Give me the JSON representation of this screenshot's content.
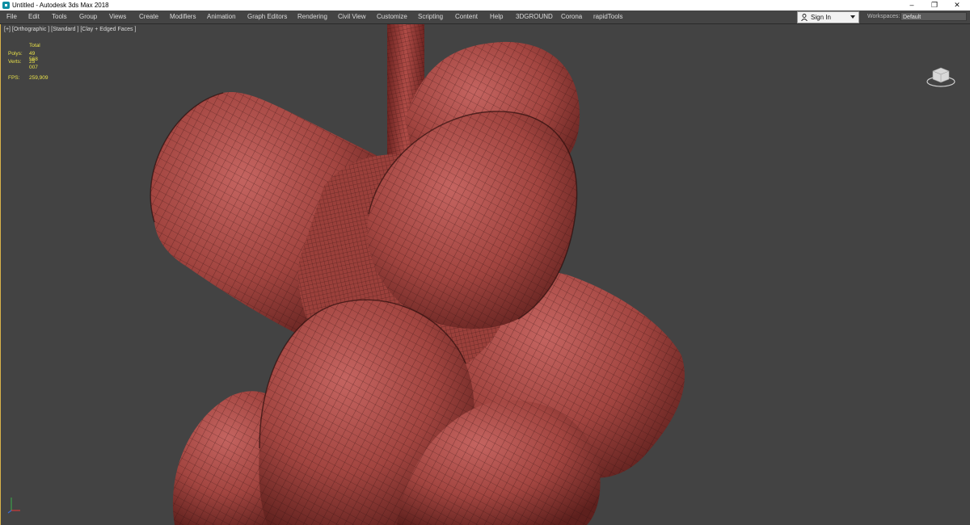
{
  "titlebar": {
    "title": "Untitled - Autodesk 3ds Max 2018",
    "minimize": "–",
    "restore": "❐",
    "close": "✕"
  },
  "menubar": {
    "items": [
      "File",
      "Edit",
      "Tools",
      "Group",
      "Views",
      "Create",
      "Modifiers",
      "Animation",
      "Graph Editors",
      "Rendering",
      "Civil View",
      "Customize",
      "Scripting",
      "Content",
      "Help",
      "3DGROUND",
      "Corona",
      "rapidTools"
    ]
  },
  "account": {
    "sign_in": "Sign In"
  },
  "workspaces": {
    "label": "Workspaces:",
    "value": "Default"
  },
  "viewport": {
    "label": "[+] [Orthographic ] [Standard ] [Clay + Edged Faces ]",
    "stats": {
      "header": "Total",
      "polys_label": "Polys:",
      "polys_value": "49 568",
      "verts_label": "Verts:",
      "verts_value": "25 007",
      "fps_label": "FPS:",
      "fps_value": "259,909"
    }
  },
  "colors": {
    "viewport_bg": "#434343",
    "clay": "#a84843",
    "stats_text": "#e9e14a",
    "active_border": "#d9b24a"
  },
  "icons": {
    "app": "3dsmax-icon",
    "account": "user-icon",
    "viewcube": "viewcube-icon",
    "axis": "axis-tripod-icon"
  }
}
